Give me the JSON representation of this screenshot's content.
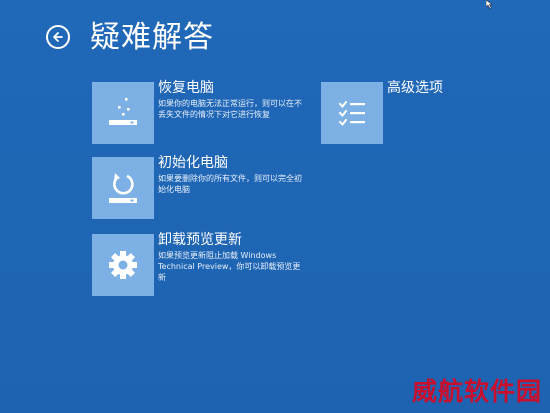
{
  "header": {
    "title": "疑难解答",
    "back_icon": "back-arrow-icon"
  },
  "options": {
    "restore": {
      "title": "恢复电脑",
      "description": "如果你的电脑无法正常运行，则可以在不丢失文件的情况下对它进行恢复",
      "icon": "sparkle-drive-icon"
    },
    "reset": {
      "title": "初始化电脑",
      "description": "如果要删除你的所有文件，则可以完全初始化电脑",
      "icon": "refresh-drive-icon"
    },
    "uninstall_preview": {
      "title": "卸载预览更新",
      "description": "如果预览更新阻止加载 Windows Technical Preview，你可以卸载预览更新",
      "icon": "gear-icon"
    },
    "advanced": {
      "title": "高级选项",
      "icon": "checklist-icon"
    }
  },
  "watermark": "威航软件园",
  "colors": {
    "background": "#1f66b5",
    "tile": "#7db0e4",
    "watermark": "#c8102e"
  }
}
